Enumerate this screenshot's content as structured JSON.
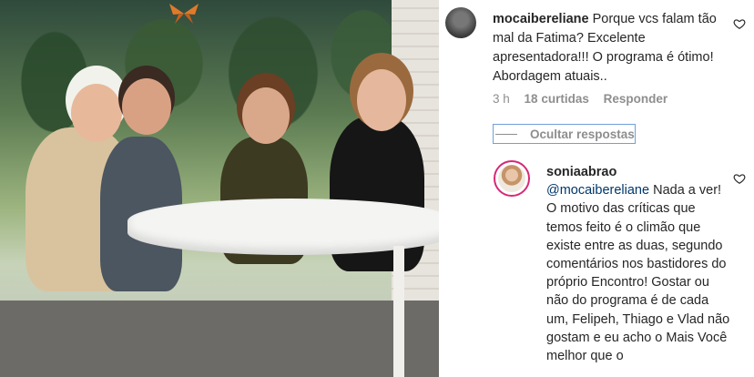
{
  "comments": [
    {
      "username": "mocaibereliane",
      "text": "Porque vcs falam tão mal da Fatima? Excelente apresentadora!!! O programa é ótimo! Abordagem atuais..",
      "time": "3 h",
      "likes": "18 curtidas",
      "reply_label": "Responder",
      "avatar_icon": "profile-avatar",
      "like_icon": "heart-outline-icon"
    },
    {
      "username": "soniaabrao",
      "mention": "@mocaibereliane",
      "text": " Nada a ver! O motivo das críticas que temos feito é o climão que existe entre as duas, segundo comentários nos bastidores do próprio Encontro! Gostar ou não do programa é de cada um, Felipeh, Thiago e Vlad não gostam e eu acho o Mais Você melhor que o",
      "avatar_icon": "story-ring-avatar",
      "like_icon": "heart-outline-icon"
    }
  ],
  "hide_replies_label": "Ocultar respostas",
  "colors": {
    "text": "#262626",
    "muted": "#8e8e8e",
    "mention": "#00376b",
    "story_ring": "#d62976"
  }
}
